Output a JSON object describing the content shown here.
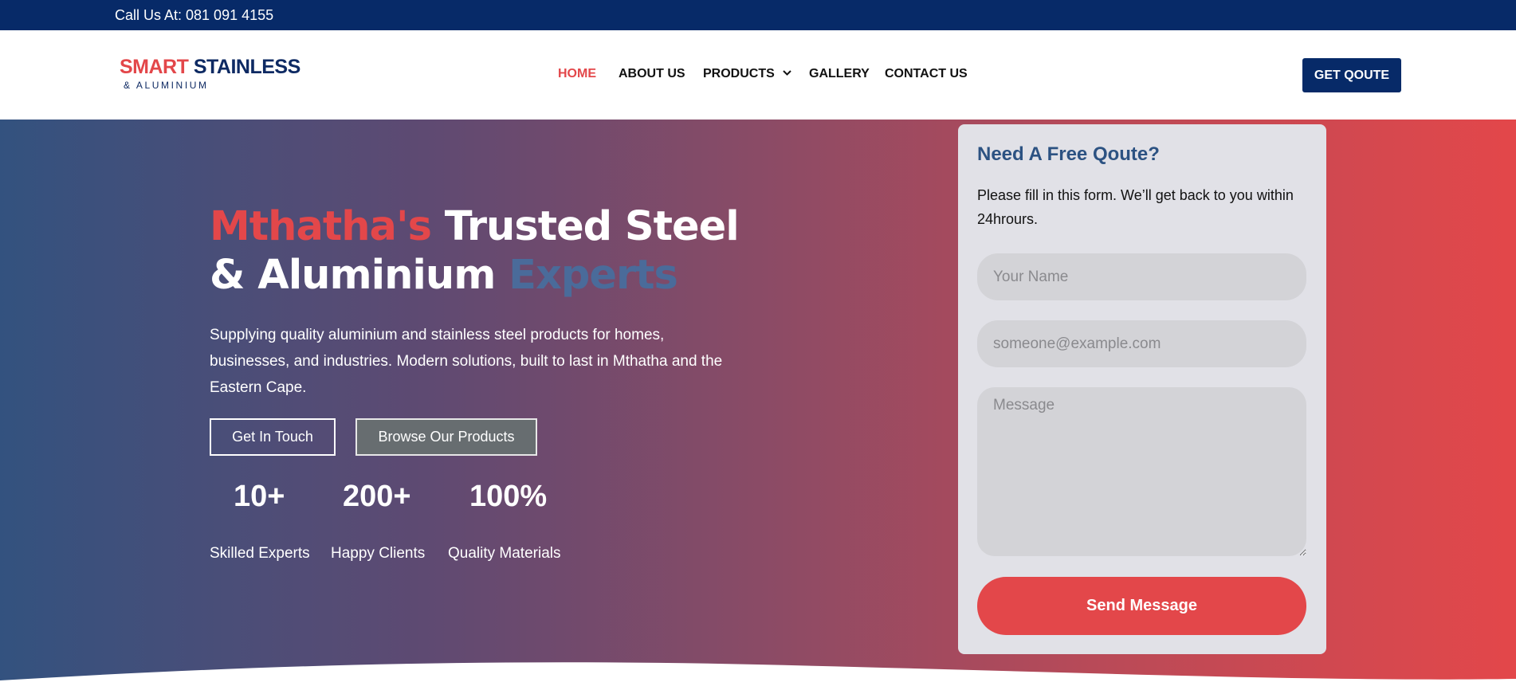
{
  "topbar": {
    "call_text": "Call Us At: 081 091 4155"
  },
  "brand": {
    "name_part1": "SMART",
    "name_part2": "STAINLESS",
    "tagline": "& ALUMINIUM"
  },
  "nav": {
    "items": [
      {
        "label": "HOME",
        "active": true
      },
      {
        "label": "ABOUT US"
      },
      {
        "label": "PRODUCTS",
        "has_dropdown": true
      },
      {
        "label": "GALLERY"
      },
      {
        "label": "CONTACT US"
      }
    ],
    "cta_label": "GET QOUTE"
  },
  "hero": {
    "heading_red": "Mthatha's",
    "heading_white1": "Trusted Steel",
    "heading_white2": "& Aluminium",
    "heading_blue": "Experts",
    "description": "Supplying quality aluminium and stainless steel products for homes, businesses, and industries. Modern solutions, built to last in Mthatha and the Eastern Cape.",
    "buttons": {
      "primary": "Get In Touch",
      "secondary": "Browse Our Products"
    },
    "stats": [
      {
        "value": "10+",
        "label": "Skilled Experts"
      },
      {
        "value": "200+",
        "label": "Happy Clients"
      },
      {
        "value": "100%",
        "label": "Quality Materials"
      }
    ]
  },
  "quote_form": {
    "title": "Need A Free Qoute?",
    "subtitle": "Please fill in this form.  We’ll get back to you within 24hrours.",
    "name_placeholder": "Your Name",
    "email_placeholder": "someone@example.com",
    "message_placeholder": "Message",
    "submit_label": "Send Message"
  },
  "colors": {
    "navy": "#072a68",
    "accent_red": "#e3474a",
    "steel_blue": "#4a6b9a",
    "card_bg": "#e1e1e7"
  }
}
